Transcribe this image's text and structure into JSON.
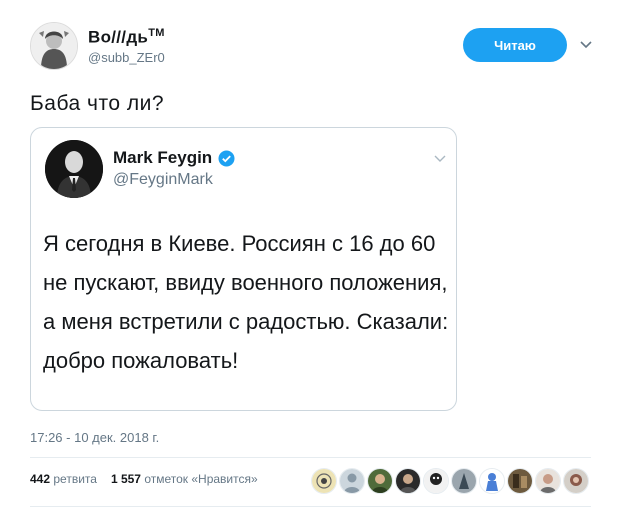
{
  "author": {
    "display_name": "Во///дь",
    "tm": "TM",
    "handle": "@subb_ZEr0",
    "avatar_icon": "avatar-portrait-icon"
  },
  "follow_button": {
    "label": "Читаю",
    "color": "#1da1f2"
  },
  "tweet": {
    "text": "Баба что ли?"
  },
  "quoted_tweet": {
    "display_name": "Mark Feygin",
    "handle": "@FeyginMark",
    "verified_icon": "verified-badge-icon",
    "verified_color": "#1da1f2",
    "text": "Я сегодня в Киеве. Россиян с 16 до 60 не пускают, ввиду военного положения, а меня встретили с радостью. Сказали: добро пожаловать!"
  },
  "timestamp": "17:26 - 10 дек. 2018 г.",
  "stats": {
    "retweets_count": "442",
    "retweets_label": "ретвита",
    "likes_count": "1 557",
    "likes_label": "отметок «Нравится»"
  },
  "likers": [
    {
      "icon": "liker-avatar-1"
    },
    {
      "icon": "liker-avatar-2"
    },
    {
      "icon": "liker-avatar-3"
    },
    {
      "icon": "liker-avatar-4"
    },
    {
      "icon": "liker-avatar-5"
    },
    {
      "icon": "liker-avatar-6"
    },
    {
      "icon": "liker-avatar-7"
    },
    {
      "icon": "liker-avatar-8"
    },
    {
      "icon": "liker-avatar-9"
    },
    {
      "icon": "liker-avatar-10"
    }
  ]
}
